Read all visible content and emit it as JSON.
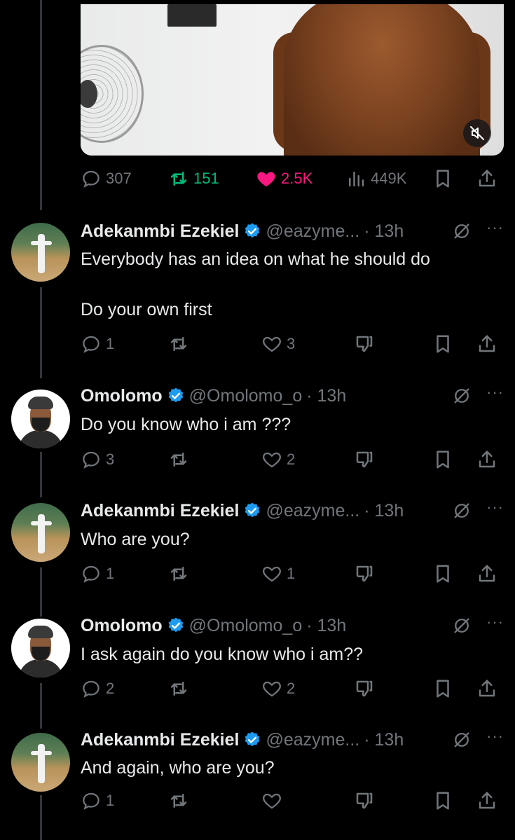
{
  "main_post": {
    "stats": {
      "replies": "307",
      "reposts": "151",
      "likes": "2.5K",
      "views": "449K"
    },
    "colors": {
      "repost": "#00ba7c",
      "like": "#f91880"
    }
  },
  "replies": [
    {
      "name": "Adekanmbi Ezekiel",
      "handle": "@eazyme...",
      "time": "· 13h",
      "text": "Everybody has an idea on what he should do\n\nDo your own first",
      "reply_count": "1",
      "like_count": "3"
    },
    {
      "name": "Omolomo",
      "handle": "@Omolomo_o",
      "time": "· 13h",
      "text": "Do you know who i am ???",
      "reply_count": "3",
      "like_count": "2"
    },
    {
      "name": "Adekanmbi Ezekiel",
      "handle": "@eazyme...",
      "time": "· 13h",
      "text": "Who are you?",
      "reply_count": "1",
      "like_count": "1"
    },
    {
      "name": "Omolomo",
      "handle": "@Omolomo_o",
      "time": "· 13h",
      "text": "I ask again do you know who i am??",
      "reply_count": "2",
      "like_count": "2"
    },
    {
      "name": "Adekanmbi Ezekiel",
      "handle": "@eazyme...",
      "time": "· 13h",
      "text": "And again, who are you?",
      "reply_count": "1",
      "like_count": ""
    }
  ],
  "more_label": "···",
  "accent": "#1d9bf0"
}
